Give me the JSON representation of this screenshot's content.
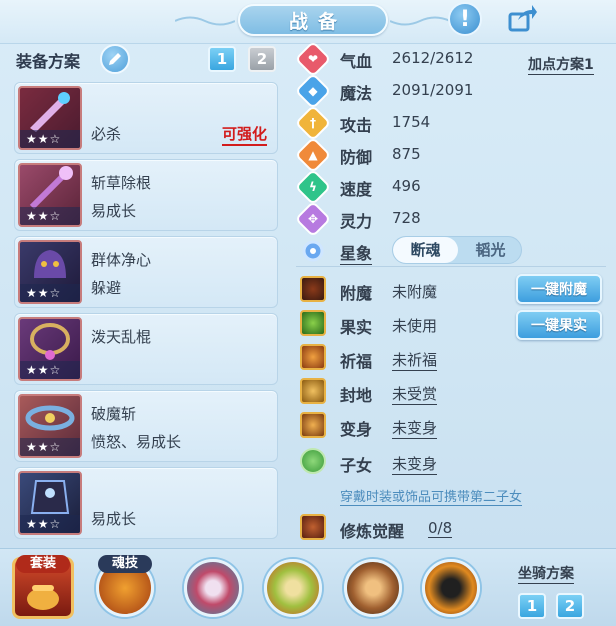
{
  "header": {
    "title": "战备"
  },
  "equip": {
    "scheme_label": "装备方案",
    "scheme_tabs": [
      "1",
      "2"
    ],
    "items": [
      {
        "line1": "",
        "line2": "必杀",
        "upgrade": "可强化",
        "stars": "★★☆"
      },
      {
        "line1": "斩草除根",
        "line2": "易成长",
        "upgrade": "",
        "stars": "★★☆"
      },
      {
        "line1": "群体净心",
        "line2": "躲避",
        "upgrade": "",
        "stars": "★★☆"
      },
      {
        "line1": "泼天乱棍",
        "line2": "",
        "upgrade": "",
        "stars": "★★☆"
      },
      {
        "line1": "破魔斩",
        "line2": "愤怒、易成长",
        "upgrade": "",
        "stars": "★★☆"
      },
      {
        "line1": "",
        "line2": "易成长",
        "upgrade": "",
        "stars": "★★☆"
      }
    ]
  },
  "stats": {
    "alloc_scheme": "加点方案1",
    "rows": [
      {
        "name": "气血",
        "value": "2612/2612",
        "color": "#e85a6b",
        "icon": "heart-icon"
      },
      {
        "name": "魔法",
        "value": "2091/2091",
        "color": "#4aa3e8",
        "icon": "shield-icon"
      },
      {
        "name": "攻击",
        "value": "1754",
        "color": "#f0b43a",
        "icon": "sword-icon"
      },
      {
        "name": "防御",
        "value": "875",
        "color": "#f08a3a",
        "icon": "armor-icon"
      },
      {
        "name": "速度",
        "value": "496",
        "color": "#2fc48a",
        "icon": "lightning-icon"
      },
      {
        "name": "灵力",
        "value": "728",
        "color": "#b77ae0",
        "icon": "spirit-icon"
      }
    ],
    "astro": {
      "name": "星象",
      "option_on": "断魂",
      "option_off": "韬光"
    }
  },
  "enchant": {
    "rows": [
      {
        "name": "附魔",
        "value": "未附魔",
        "underline": false
      },
      {
        "name": "果实",
        "value": "未使用",
        "underline": false
      },
      {
        "name": "祈福",
        "value": "未祈福",
        "underline": true
      },
      {
        "name": "封地",
        "value": "未受赏",
        "underline": true
      },
      {
        "name": "变身",
        "value": "未变身",
        "underline": true
      },
      {
        "name": "子女",
        "value": "未变身",
        "underline": true
      }
    ],
    "btn_enchant": "一键附魔",
    "btn_fruit": "一键果实",
    "hint": "穿戴时装或饰品可携带第二子女",
    "cultivate_name": "修炼觉醒",
    "cultivate_value": "0/8"
  },
  "bottom": {
    "set_label": "套装",
    "soul_label": "魂技",
    "mount_label": "坐骑方案",
    "mount_tabs": [
      "1",
      "2"
    ]
  }
}
